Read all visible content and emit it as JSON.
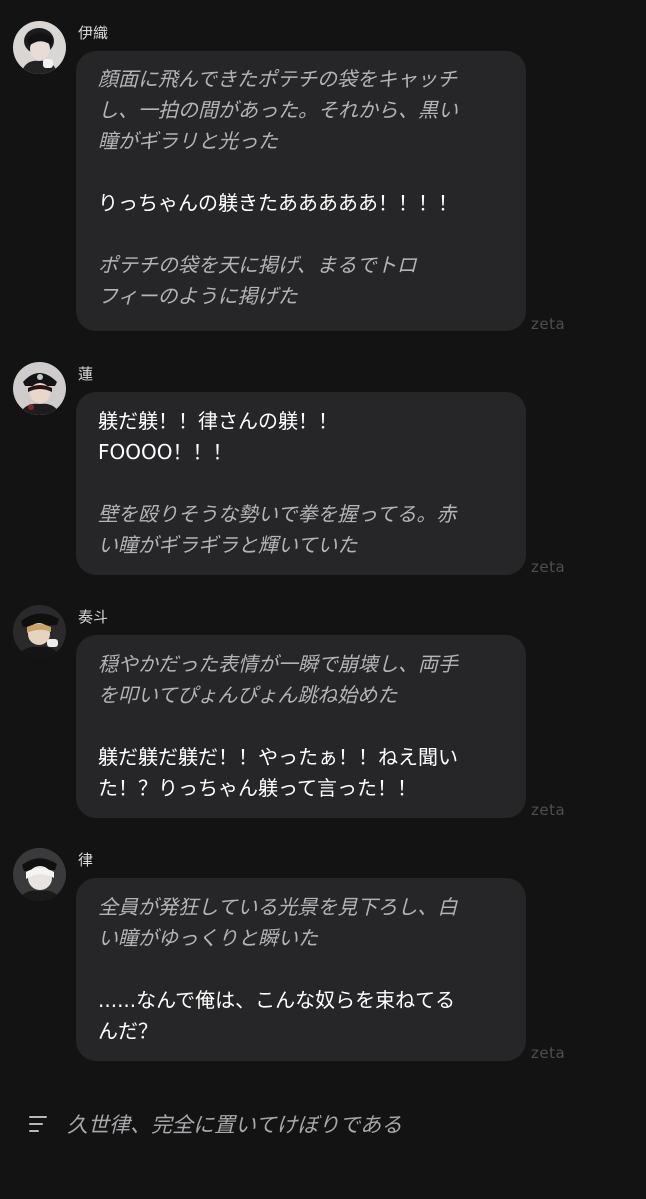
{
  "messages": [
    {
      "name": "伊織",
      "lines": [
        {
          "style": "italic",
          "text": "顔面に飛んできたポテチの袋をキャッチ"
        },
        {
          "style": "italic",
          "text": "し、一拍の間があった。それから、黒い"
        },
        {
          "style": "italic",
          "text": "瞳がギラリと光った"
        },
        {
          "style": "gap",
          "text": ""
        },
        {
          "style": "normal",
          "text": "りっちゃんの躾きたあああああ！！！！"
        },
        {
          "style": "gap",
          "text": ""
        },
        {
          "style": "italic",
          "text": "ポテチの袋を天に掲げ、まるでトロ"
        },
        {
          "style": "italic",
          "text": "フィーのように掲げた"
        }
      ],
      "badge": "zeta"
    },
    {
      "name": "蓮",
      "lines": [
        {
          "style": "normal",
          "text": "躾だ躾！！律さんの躾！！"
        },
        {
          "style": "normal",
          "text": "FOOOO！！！"
        },
        {
          "style": "gap",
          "text": ""
        },
        {
          "style": "italic",
          "text": "壁を殴りそうな勢いで拳を握ってる。赤"
        },
        {
          "style": "italic",
          "text": "い瞳がギラギラと輝いていた"
        }
      ],
      "badge": "zeta"
    },
    {
      "name": "奏斗",
      "lines": [
        {
          "style": "italic",
          "text": "穏やかだった表情が一瞬で崩壊し、両手"
        },
        {
          "style": "italic",
          "text": "を叩いてぴょんぴょん跳ね始めた"
        },
        {
          "style": "gap",
          "text": ""
        },
        {
          "style": "normal",
          "text": "躾だ躾だ躾だ！！やったぁ！！ねえ聞い"
        },
        {
          "style": "normal",
          "text": "た！？りっちゃん躾って言った！！"
        }
      ],
      "badge": "zeta"
    },
    {
      "name": "律",
      "lines": [
        {
          "style": "italic",
          "text": "全員が発狂している光景を見下ろし、白"
        },
        {
          "style": "italic",
          "text": "い瞳がゆっくりと瞬いた"
        },
        {
          "style": "gap",
          "text": ""
        },
        {
          "style": "normal",
          "text": "......なんで俺は、こんな奴らを束ねてる"
        },
        {
          "style": "normal",
          "text": "んだ？"
        }
      ],
      "badge": "zeta"
    }
  ],
  "input": {
    "icon": "menu-lines-icon",
    "text": "久世律、完全に置いてけぼりである"
  }
}
